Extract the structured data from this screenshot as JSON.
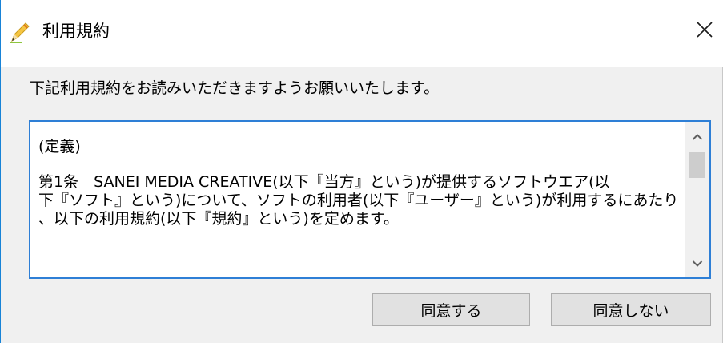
{
  "window": {
    "title": "利用規約",
    "icon": "pencil-icon",
    "close_icon": "close-icon",
    "accent_border": "#1883d7"
  },
  "instruction": "下記利用規約をお読みいただきますようお願いいたします。",
  "terms": {
    "heading": "(定義)",
    "article_1": "第1条　SANEI MEDIA CREATIVE(以下『当方』という)が提供するソフトウエア(以\n下『ソフト』という)について、ソフトの利用者(以下『ユーザー』という)が利用するにあたり\n、以下の利用規約(以下『規約』という)を定めます。",
    "border_color": "#2e7fd6",
    "scroll_up_icon": "chevron-up-icon",
    "scroll_down_icon": "chevron-down-icon"
  },
  "buttons": {
    "agree": "同意する",
    "disagree": "同意しない"
  }
}
